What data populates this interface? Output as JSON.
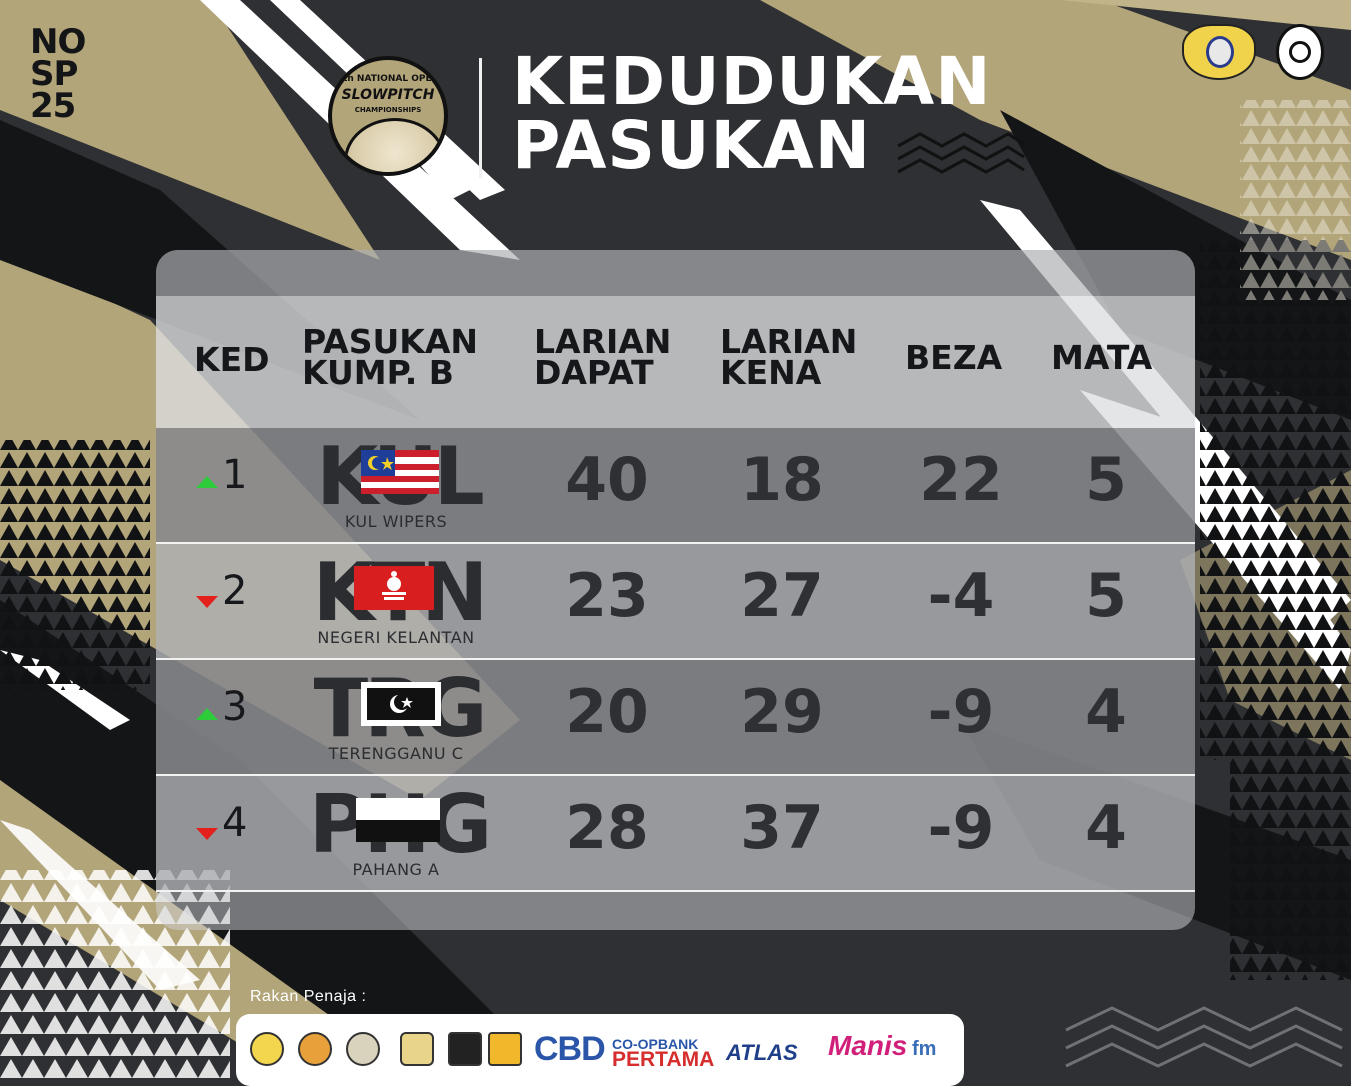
{
  "code": [
    "NO",
    "SP",
    "25"
  ],
  "event_logo": {
    "line1": "4th NATIONAL OPEN",
    "line2": "SLOWPITCH",
    "line3": "CHAMPIONSHIPS"
  },
  "title": [
    "KEDUDUKAN",
    "PASUKAN"
  ],
  "table": {
    "headers": {
      "ked": "KED",
      "pasukan": [
        "PASUKAN",
        "KUMP. B"
      ],
      "larian_dapat": [
        "LARIAN",
        "DAPAT"
      ],
      "larian_kena": [
        "LARIAN",
        "KENA"
      ],
      "beza": "BEZA",
      "mata": "MATA"
    },
    "rows": [
      {
        "rank": "1",
        "trend": "up",
        "code": "KUL",
        "name": "KUL WIPERS",
        "larian_dapat": "40",
        "larian_kena": "18",
        "beza": "22",
        "mata": "5"
      },
      {
        "rank": "2",
        "trend": "down",
        "code": "KTN",
        "name": "NEGERI KELANTAN",
        "larian_dapat": "23",
        "larian_kena": "27",
        "beza": "-4",
        "mata": "5"
      },
      {
        "rank": "3",
        "trend": "up",
        "code": "TRG",
        "name": "TERENGGANU C",
        "larian_dapat": "20",
        "larian_kena": "29",
        "beza": "-9",
        "mata": "4"
      },
      {
        "rank": "4",
        "trend": "down",
        "code": "PHG",
        "name": "PAHANG A",
        "larian_dapat": "28",
        "larian_kena": "37",
        "beza": "-9",
        "mata": "4"
      }
    ]
  },
  "sponsors": {
    "label": "Rakan Penaja :",
    "cbd": "CBD",
    "coopbank": "CO-OPBANK",
    "pertama": "PERTAMA",
    "atlas": "ATLAS",
    "manis": "Manis",
    "fm": "fm"
  },
  "colors": {
    "gold": "#b3a57a",
    "dark": "#2e3033",
    "trend_up": "#2ecc3a",
    "trend_down": "#e3201b"
  }
}
